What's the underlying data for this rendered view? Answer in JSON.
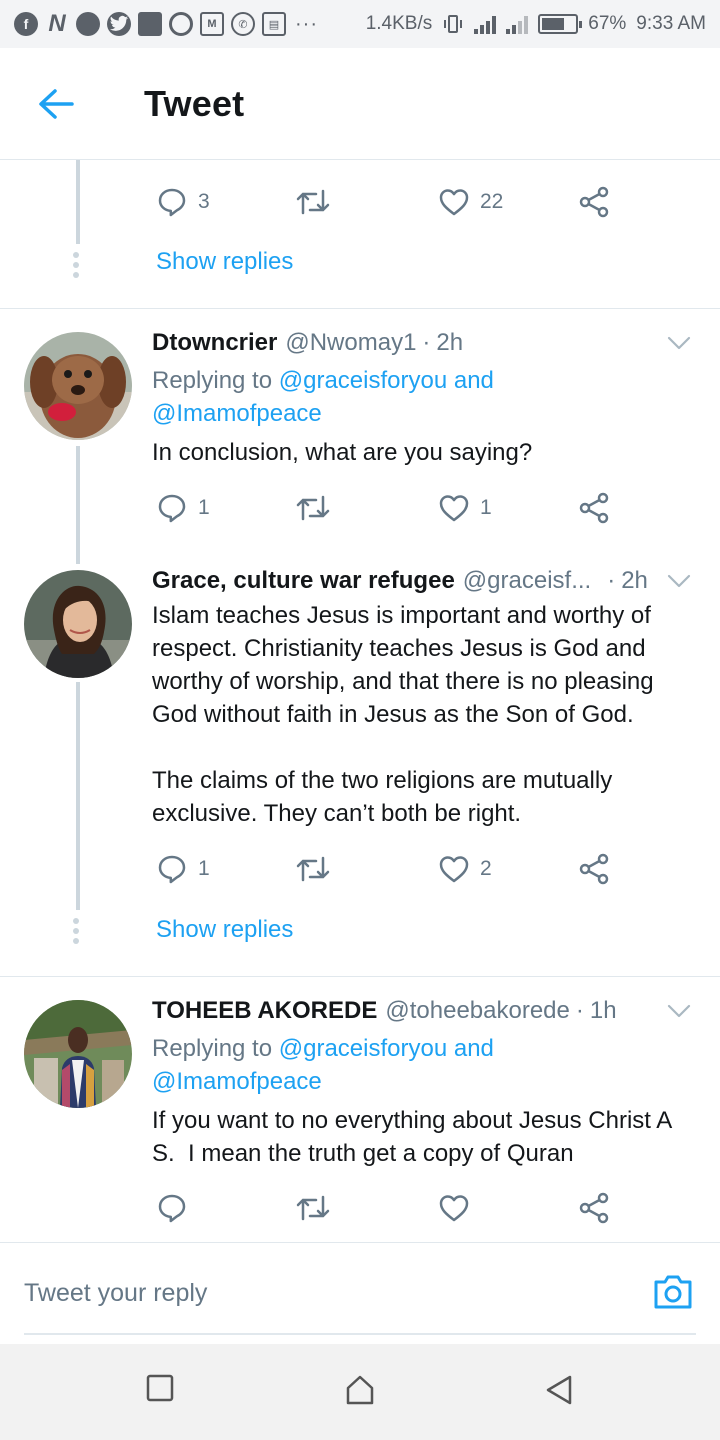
{
  "status_bar": {
    "left_icons": [
      "facebook-icon",
      "n-icon",
      "dot-icon",
      "twitter-icon",
      "square-icon",
      "opera-icon",
      "gmail-icon",
      "whatsapp-icon",
      "calendar-icon"
    ],
    "overflow": "···",
    "speed": "1.4KB/s",
    "battery": "67%",
    "battery_level": 0.67,
    "time": "9:33 AM"
  },
  "header": {
    "title": "Tweet",
    "back_icon": "arrow-left-icon"
  },
  "colors": {
    "accent": "#1da1f2",
    "text": "#14171a",
    "muted": "#657786",
    "line": "#ccd6dd"
  },
  "top_thread": {
    "reply_count": "3",
    "like_count": "22",
    "show_replies": "Show replies"
  },
  "tweets": [
    {
      "name": "Dtowncrier",
      "handle": "@Nwomay1",
      "sep": "·",
      "time": "2h",
      "replying_prefix": "Replying to ",
      "replying_link1": "@graceisforyou and",
      "replying_link2": "@Imamofpeace",
      "text": "In conclusion, what are you saying?",
      "reply_count": "1",
      "retweet_count": "",
      "like_count": "1"
    },
    {
      "name": "Grace, culture war refugee",
      "handle": "@graceisf...",
      "sep": "·",
      "time": "2h",
      "text": "Islam teaches Jesus is important and worthy of respect. Christianity teaches Jesus is God and worthy of worship, and that there is no pleasing God without faith in Jesus as the Son of God.\n\nThe claims of the two religions are mutually exclusive. They can’t both be right.",
      "reply_count": "1",
      "retweet_count": "",
      "like_count": "2",
      "show_replies": "Show replies"
    },
    {
      "name": "TOHEEB AKOREDE",
      "handle": "@toheebakorede",
      "sep": "·",
      "time": "1h",
      "replying_prefix": "Replying to ",
      "replying_link1": "@graceisforyou and",
      "replying_link2": "@Imamofpeace",
      "text": "If you want to no everything about Jesus Christ A S.  I mean the truth get a copy of Quran",
      "reply_count": "",
      "retweet_count": "",
      "like_count": ""
    }
  ],
  "compose": {
    "placeholder": "Tweet your reply",
    "camera_icon": "camera-icon"
  },
  "nav_bar": {
    "icons": [
      "recents-square-icon",
      "home-icon",
      "back-triangle-icon"
    ]
  }
}
